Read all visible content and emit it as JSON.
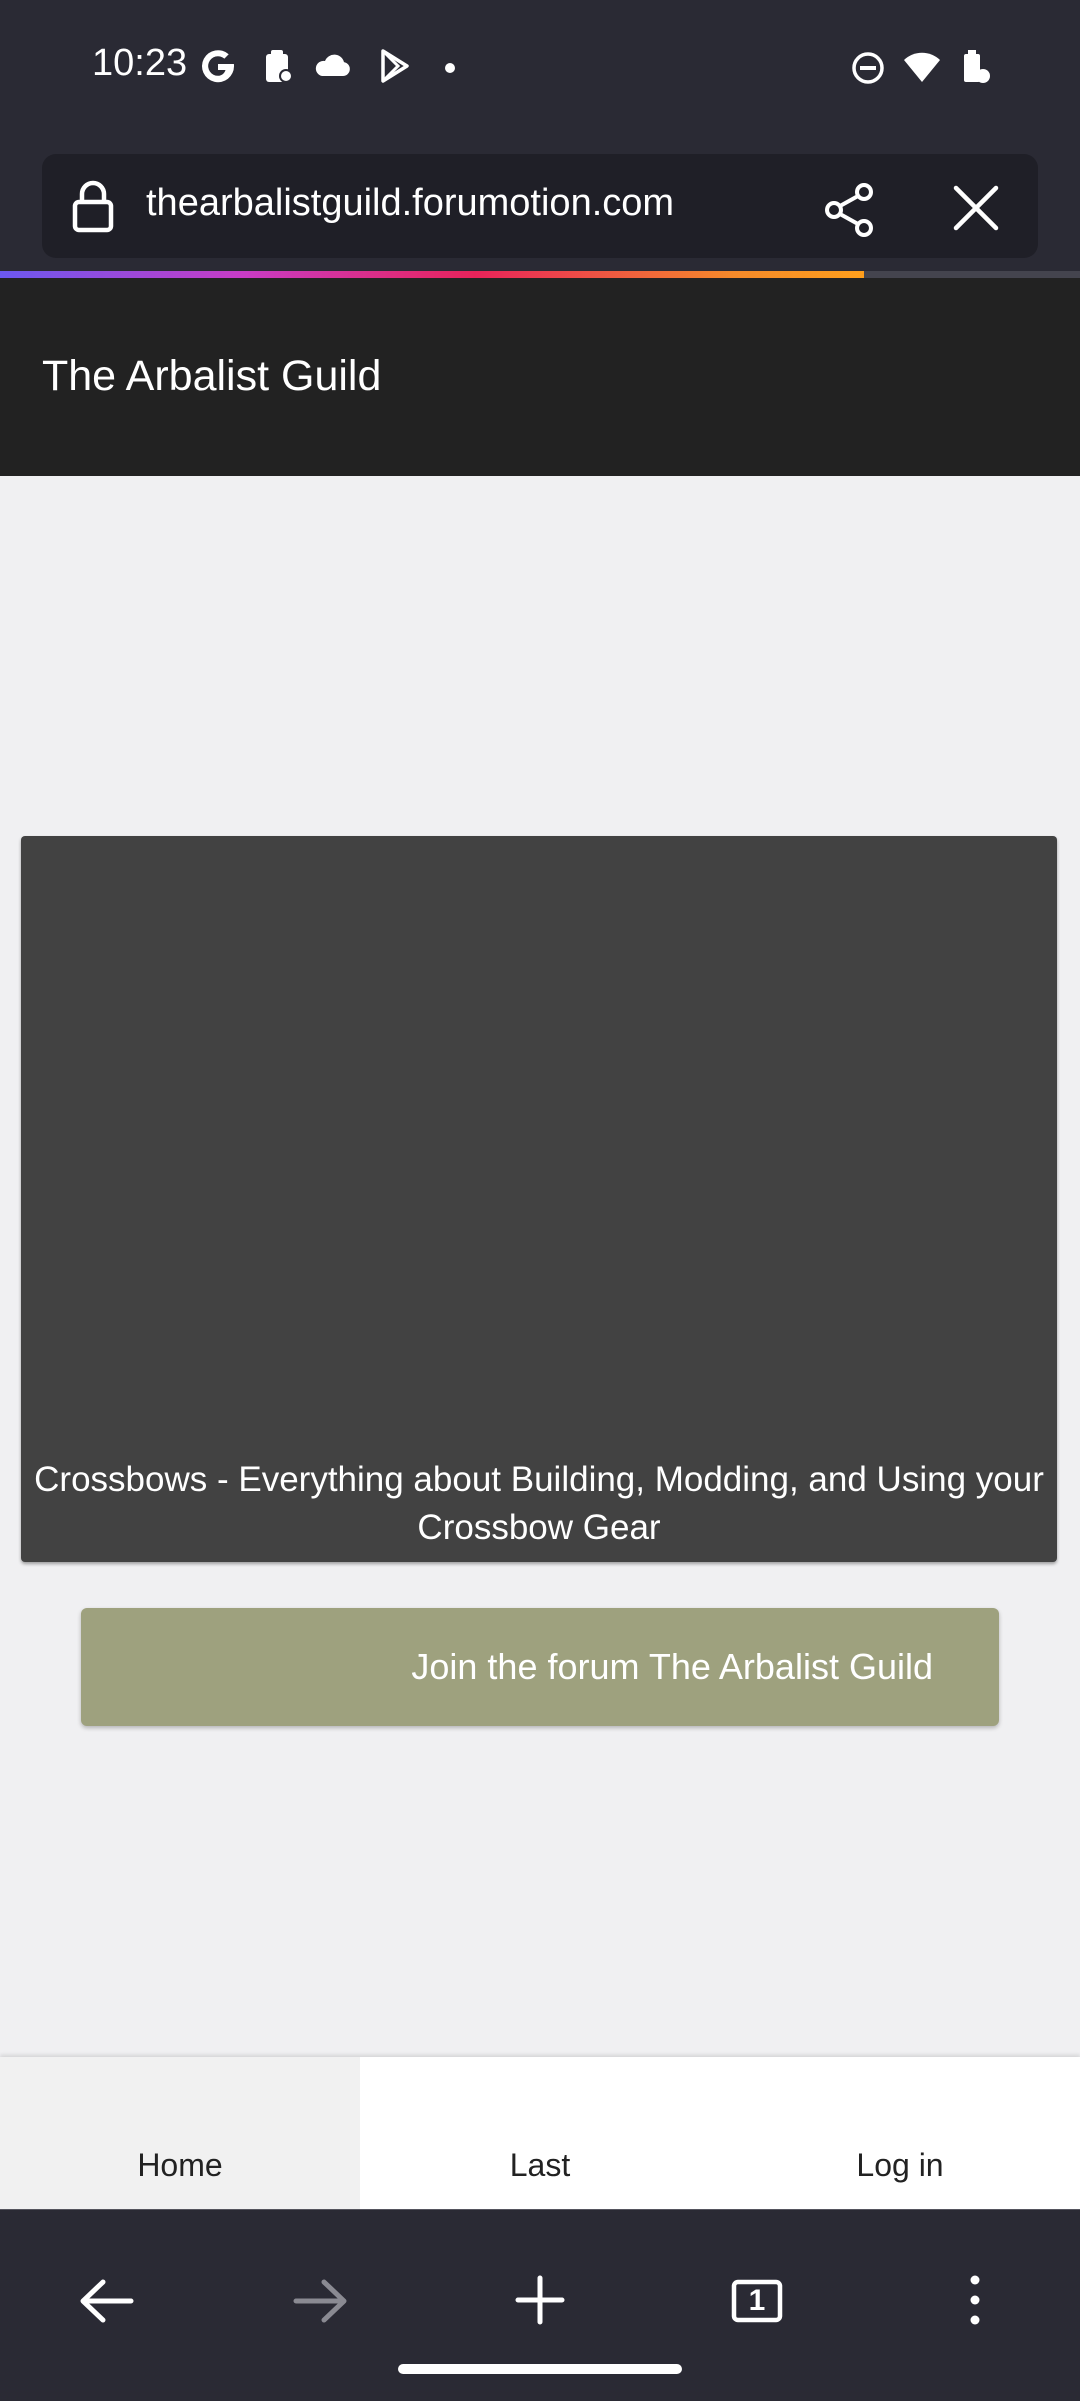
{
  "status_bar": {
    "time": "10:23",
    "left_icons": [
      "google-icon",
      "clipboard-icon",
      "cloud-icon",
      "play-store-icon",
      "dot-icon"
    ],
    "right_icons": [
      "do-not-disturb-icon",
      "wifi-icon",
      "battery-icon"
    ]
  },
  "browser": {
    "url": "thearbalistguild.forumotion.com",
    "page_load_progress": 0.8,
    "tab_count": "1"
  },
  "forum": {
    "title": "The Arbalist Guild",
    "banner_text": "Crossbows - Everything about Building, Modding, and Using your Crossbow Gear",
    "join_button_label": "Join the forum The Arbalist Guild",
    "nav": {
      "home": "Home",
      "last": "Last",
      "login": "Log in"
    }
  },
  "colors": {
    "forum_header_bg": "#222222",
    "banner_bg": "#424242",
    "join_button_bg": "#9ea17e",
    "chrome_bg": "#2a2a34"
  }
}
